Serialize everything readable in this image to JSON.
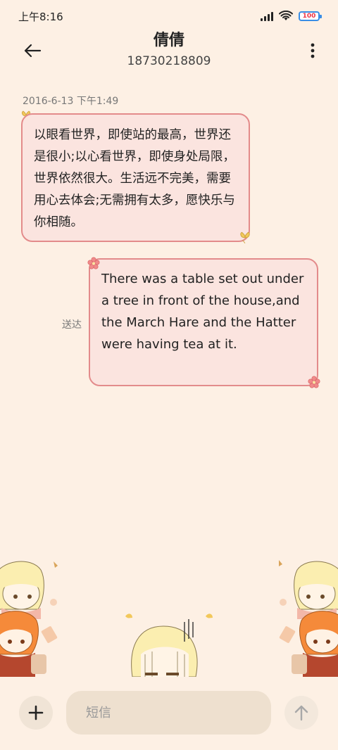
{
  "status_bar": {
    "time": "上午8:16",
    "battery_label": "100"
  },
  "header": {
    "contact_name": "倩倩",
    "phone_number": "18730218809"
  },
  "conversation": {
    "timestamp": "2016-6-13 下午1:49",
    "incoming_message": "以眼看世界，即使站的最高，世界还是很小;以心看世界，即使身处局限，世界依然很大。生活远不完美，需要用心去体会;无需拥有太多，愿快乐与你相随。",
    "outgoing_message": "There was a table set out under a tree in front of the house,and the March Hare and the Hatter were having tea at it.",
    "outgoing_status": "送达"
  },
  "composer": {
    "placeholder": "短信"
  },
  "colors": {
    "background": "#fdf0e4",
    "bubble_fill": "#fbe4df",
    "bubble_border": "#e38b8b",
    "battery_accent": "#3a8ee6"
  },
  "icons": {
    "back": "back-arrow-icon",
    "menu": "more-vertical-icon",
    "add": "plus-icon",
    "send": "arrow-up-icon"
  }
}
